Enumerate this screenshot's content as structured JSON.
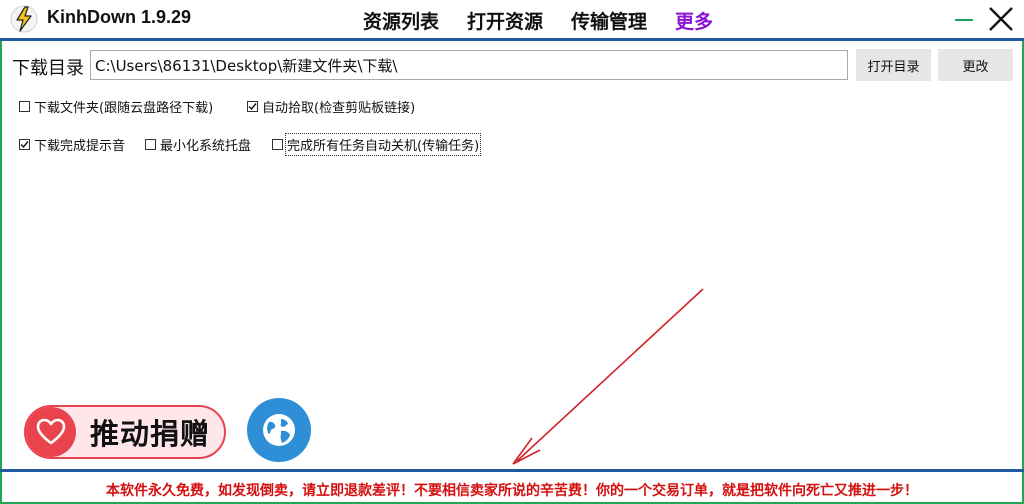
{
  "app": {
    "title": "KinhDown 1.9.29",
    "icon": "lightning-icon"
  },
  "nav": {
    "items": [
      {
        "label": "资源列表"
      },
      {
        "label": "打开资源"
      },
      {
        "label": "传输管理"
      },
      {
        "label": "更多"
      }
    ],
    "more_color": "#8a14d6"
  },
  "window_controls": {
    "minimize_icon": "minimize-icon",
    "close_icon": "close-icon"
  },
  "download": {
    "label": "下载目录",
    "path": "C:\\Users\\86131\\Desktop\\新建文件夹\\下载\\",
    "open_button": "打开目录",
    "change_button": "更改"
  },
  "options": [
    {
      "label": "下载文件夹(跟随云盘路径下载)",
      "checked": false
    },
    {
      "label": "自动拾取(检查剪贴板链接)",
      "checked": true
    },
    {
      "label": "下载完成提示音",
      "checked": true
    },
    {
      "label": "最小化系统托盘",
      "checked": false
    },
    {
      "label": "完成所有任务自动关机(传输任务)",
      "checked": false
    }
  ],
  "donate": {
    "label": "推动捐赠",
    "icon": "heart-icon"
  },
  "website": {
    "icon": "globe-icon"
  },
  "footer": {
    "notice": "本软件永久免费，如发现倒卖，请立即退款差评！不要相信卖家所说的辛苦费！你的一个交易订单，就是把软件向死亡又推进一步！"
  },
  "colors": {
    "border_green": "#21a857",
    "divider_blue": "#1f5aa0",
    "accent_red": "#e9434d",
    "footer_red": "#d40f0f",
    "globe_blue": "#2f8fd6"
  }
}
